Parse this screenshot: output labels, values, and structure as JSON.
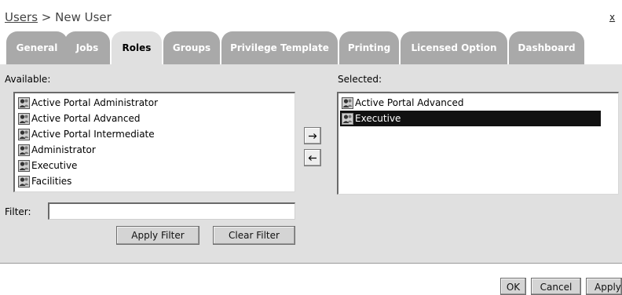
{
  "header": {
    "breadcrumb_link": "Users",
    "breadcrumb_sep": " > ",
    "breadcrumb_current": "New User",
    "close_label": "x"
  },
  "tabs": [
    {
      "label": "General",
      "active": false
    },
    {
      "label": "Jobs",
      "active": false
    },
    {
      "label": "Roles",
      "active": true
    },
    {
      "label": "Groups",
      "active": false
    },
    {
      "label": "Privilege Template",
      "active": false
    },
    {
      "label": "Printing",
      "active": false
    },
    {
      "label": "Licensed Option",
      "active": false
    },
    {
      "label": "Dashboard",
      "active": false
    }
  ],
  "roles": {
    "available_label": "Available:",
    "selected_label": "Selected:",
    "available": [
      "Active Portal Administrator",
      "Active Portal Advanced",
      "Active Portal Intermediate",
      "Administrator",
      "Executive",
      "Facilities"
    ],
    "selected": [
      {
        "label": "Active Portal Advanced",
        "selected": false
      },
      {
        "label": "Executive",
        "selected": true
      }
    ],
    "add_arrow": "→",
    "remove_arrow": "←",
    "role_icon": "role-user-icon"
  },
  "filter": {
    "label": "Filter:",
    "value": "",
    "apply_label": "Apply Filter",
    "clear_label": "Clear Filter"
  },
  "footer": {
    "ok_label": "OK",
    "cancel_label": "Cancel",
    "apply_label": "Apply"
  },
  "colors": {
    "tab_inactive": "#a9a9a9",
    "tab_active": "#e0e0e0",
    "panel_bg": "#e0e0e0",
    "selection_bg": "#111111"
  }
}
